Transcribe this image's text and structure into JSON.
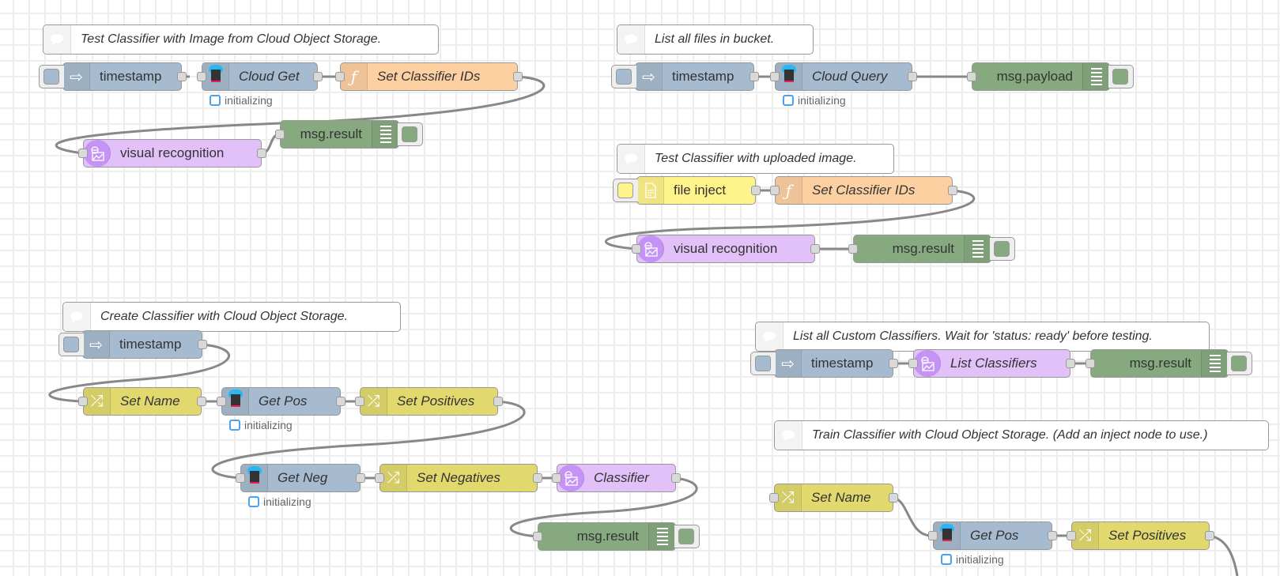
{
  "canvas": {
    "grid": true,
    "background": "#ffffff",
    "grid_color": "#eeeeee"
  },
  "colors": {
    "inject": "#a6bbcf",
    "function": "#fdd0a2",
    "watson": "#e2c0f8",
    "debug": "#87a980",
    "change": "#e2d96e",
    "file_inject": "#fff38b",
    "status_blue": "#4aa3f0",
    "wire": "#888888"
  },
  "comments": [
    {
      "id": "c1",
      "text": "Test Classifier with Image from Cloud Object Storage."
    },
    {
      "id": "c2",
      "text": "List all files in bucket."
    },
    {
      "id": "c3",
      "text": "Test Classifier with uploaded image."
    },
    {
      "id": "c4",
      "text": "Create Classifier with Cloud Object Storage."
    },
    {
      "id": "c5",
      "text": "List all Custom Classifiers. Wait for 'status: ready' before testing."
    },
    {
      "id": "c6",
      "text": "Train Classifier with Cloud Object Storage. (Add an inject node to use.)"
    }
  ],
  "nodes": {
    "f1_inject": {
      "label": "timestamp",
      "type": "inject",
      "icon": "arrow-in-icon"
    },
    "f1_cloudget": {
      "label": "Cloud Get",
      "type": "cloud-object-storage",
      "icon": "cloud-storage-icon",
      "status": "initializing"
    },
    "f1_setids": {
      "label": "Set Classifier IDs",
      "type": "function",
      "icon": "function-icon"
    },
    "f1_vr": {
      "label": "visual recognition",
      "type": "visual-recognition",
      "icon": "visual-recognition-icon"
    },
    "f1_debug": {
      "label": "msg.result",
      "type": "debug",
      "icon": "list-icon"
    },
    "f2_inject": {
      "label": "timestamp",
      "type": "inject",
      "icon": "arrow-in-icon"
    },
    "f2_query": {
      "label": "Cloud Query",
      "type": "cloud-object-storage",
      "icon": "cloud-storage-icon",
      "status": "initializing"
    },
    "f2_debug": {
      "label": "msg.payload",
      "type": "debug",
      "icon": "list-icon"
    },
    "f3_file": {
      "label": "file inject",
      "type": "file-inject",
      "icon": "file-icon"
    },
    "f3_setids": {
      "label": "Set Classifier IDs",
      "type": "function",
      "icon": "function-icon"
    },
    "f3_vr": {
      "label": "visual recognition",
      "type": "visual-recognition",
      "icon": "visual-recognition-icon"
    },
    "f3_debug": {
      "label": "msg.result",
      "type": "debug",
      "icon": "list-icon"
    },
    "f4_inject": {
      "label": "timestamp",
      "type": "inject",
      "icon": "arrow-in-icon"
    },
    "f4_setname": {
      "label": "Set Name",
      "type": "change",
      "icon": "shuffle-icon"
    },
    "f4_getpos": {
      "label": "Get Pos",
      "type": "cloud-object-storage",
      "icon": "cloud-storage-icon",
      "status": "initializing"
    },
    "f4_setpos": {
      "label": "Set Positives",
      "type": "change",
      "icon": "shuffle-icon"
    },
    "f4_getneg": {
      "label": "Get Neg",
      "type": "cloud-object-storage",
      "icon": "cloud-storage-icon",
      "status": "initializing"
    },
    "f4_setneg": {
      "label": "Set Negatives",
      "type": "change",
      "icon": "shuffle-icon"
    },
    "f4_classifier": {
      "label": "Classifier",
      "type": "visual-recognition",
      "icon": "visual-recognition-icon"
    },
    "f4_debug": {
      "label": "msg.result",
      "type": "debug",
      "icon": "list-icon"
    },
    "f5_inject": {
      "label": "timestamp",
      "type": "inject",
      "icon": "arrow-in-icon"
    },
    "f5_list": {
      "label": "List Classifiers",
      "type": "visual-recognition",
      "icon": "visual-recognition-icon"
    },
    "f5_debug": {
      "label": "msg.result",
      "type": "debug",
      "icon": "list-icon"
    },
    "f6_setname": {
      "label": "Set Name",
      "type": "change",
      "icon": "shuffle-icon"
    },
    "f6_getpos": {
      "label": "Get Pos",
      "type": "cloud-object-storage",
      "icon": "cloud-storage-icon",
      "status": "initializing"
    },
    "f6_setpos": {
      "label": "Set Positives",
      "type": "change",
      "icon": "shuffle-icon"
    }
  }
}
